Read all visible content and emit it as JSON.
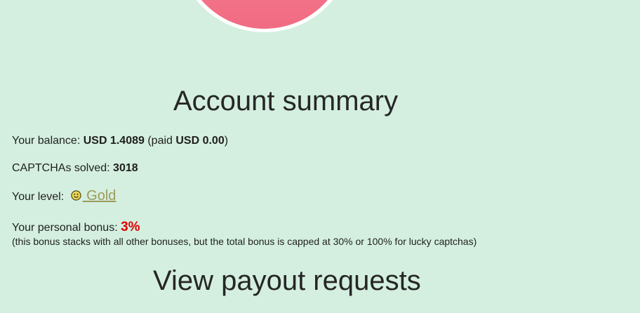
{
  "account": {
    "title": "Account summary",
    "balance": {
      "label": "Your balance: ",
      "value": "USD 1.4089",
      "paid_prefix": " (paid ",
      "paid_value": "USD 0.00",
      "paid_suffix": ")"
    },
    "captchas": {
      "label": "CAPTCHAs solved: ",
      "value": "3018"
    },
    "level": {
      "label": "Your level: ",
      "value": " Gold",
      "icon": "level-badge-icon"
    },
    "bonus": {
      "label": "Your personal bonus: ",
      "value": "3%",
      "note": "(this bonus stacks with all other bonuses, but the total bonus is capped at 30% or 100% for lucky captchas)"
    }
  },
  "payouts": {
    "title": "View payout requests"
  },
  "colors": {
    "background": "#d4efdf",
    "circle": "#f06b82",
    "bonus_accent": "#e00000",
    "level_link": "#9d9a5b"
  }
}
